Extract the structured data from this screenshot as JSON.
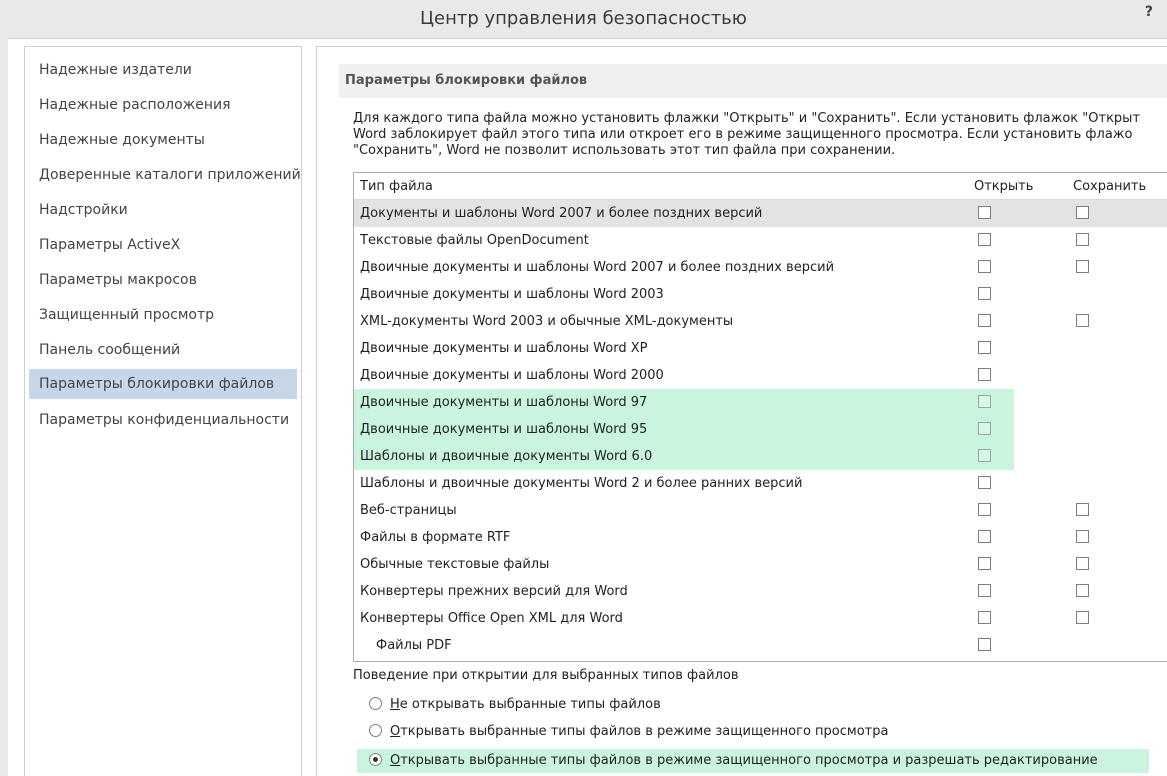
{
  "window": {
    "title": "Центр управления безопасностью",
    "help": "?"
  },
  "sidebar": {
    "items": [
      {
        "label": "Надежные издатели"
      },
      {
        "label": "Надежные расположения"
      },
      {
        "label": "Надежные документы"
      },
      {
        "label": "Доверенные каталоги приложений"
      },
      {
        "label": "Надстройки"
      },
      {
        "label": "Параметры ActiveX"
      },
      {
        "label": "Параметры макросов"
      },
      {
        "label": "Защищенный просмотр"
      },
      {
        "label": "Панель сообщений"
      },
      {
        "label": "Параметры блокировки файлов",
        "selected": true
      },
      {
        "label": "Параметры конфиденциальности"
      }
    ]
  },
  "main": {
    "section_title": "Параметры блокировки файлов",
    "description": [
      "Для каждого типа файла можно установить флажки \"Открыть\" и \"Сохранить\". Если установить флажок \"Открыт",
      "Word заблокирует файл этого типа или откроет его в режиме защищенного просмотра. Если установить флажо",
      "\"Сохранить\", Word не позволит использовать этот тип файла при сохранении."
    ],
    "table": {
      "headers": {
        "type": "Тип файла",
        "open": "Открыть",
        "save": "Сохранить"
      },
      "rows": [
        {
          "name": "Документы и шаблоны Word 2007 и более поздних версий",
          "open": false,
          "save": false
        },
        {
          "name": "Текстовые файлы OpenDocument",
          "open": false,
          "save": false
        },
        {
          "name": "Двоичные документы и шаблоны Word 2007 и более поздних версий",
          "open": false,
          "save": false
        },
        {
          "name": "Двоичные документы и шаблоны Word 2003",
          "open": false
        },
        {
          "name": "XML-документы Word 2003 и обычные XML-документы",
          "open": false,
          "save": false
        },
        {
          "name": "Двоичные документы и шаблоны Word XP",
          "open": false
        },
        {
          "name": "Двоичные документы и шаблоны Word 2000",
          "open": false
        },
        {
          "name": "Двоичные документы и шаблоны Word 97",
          "open": false
        },
        {
          "name": "Двоичные документы и шаблоны Word 95",
          "open": false
        },
        {
          "name": "Шаблоны и двоичные документы Word 6.0",
          "open": false
        },
        {
          "name": "Шаблоны и двоичные документы Word 2 и более ранних версий",
          "open": false
        },
        {
          "name": "Веб-страницы",
          "open": false,
          "save": false
        },
        {
          "name": "Файлы в формате RTF",
          "open": false,
          "save": false
        },
        {
          "name": "Обычные текстовые файлы",
          "open": false,
          "save": false
        },
        {
          "name": "Конвертеры прежних версий для Word",
          "open": false,
          "save": false
        },
        {
          "name": "Конвертеры Office Open XML для Word",
          "open": false,
          "save": false
        },
        {
          "name": "Файлы PDF",
          "open": false
        }
      ]
    },
    "behavior": {
      "label": "Поведение при открытии для выбранных типов файлов",
      "options": [
        {
          "first": "Н",
          "rest": "е открывать выбранные типы файлов",
          "checked": false
        },
        {
          "first": "О",
          "rest": "ткрывать выбранные типы файлов в режиме защищенного просмотра",
          "checked": false
        },
        {
          "first": "О",
          "rest": "ткрывать выбранные типы файлов в режиме защищенного просмотра и разрешать редактирование",
          "checked": true
        }
      ]
    }
  },
  "colors": {
    "selection": "#c6d7ec",
    "highlight": "#c9f5df",
    "row_selected": "#e3e3e6",
    "titlebar": "#e9e9e9"
  }
}
